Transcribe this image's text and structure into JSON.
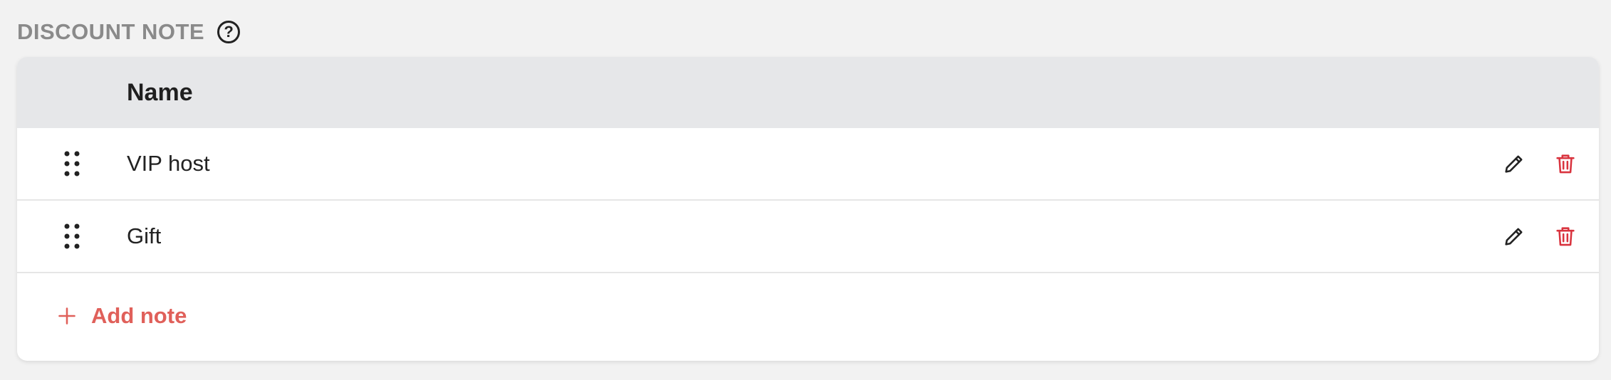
{
  "section": {
    "title": "DISCOUNT NOTE",
    "help_icon": "question-circle-icon"
  },
  "table": {
    "column_name": "Name",
    "rows": [
      {
        "name": "VIP host",
        "icons": [
          "drag-handle-icon",
          "pencil-icon",
          "trash-icon"
        ]
      },
      {
        "name": "Gift",
        "icons": [
          "drag-handle-icon",
          "pencil-icon",
          "trash-icon"
        ]
      }
    ]
  },
  "add_note": {
    "label": "Add note",
    "icon": "plus-icon"
  },
  "colors": {
    "accent": "#e0605a",
    "delete": "#d9343f",
    "header_bg": "#e6e7e9",
    "page_bg": "#f2f2f2",
    "section_title": "#8a8a8a"
  }
}
